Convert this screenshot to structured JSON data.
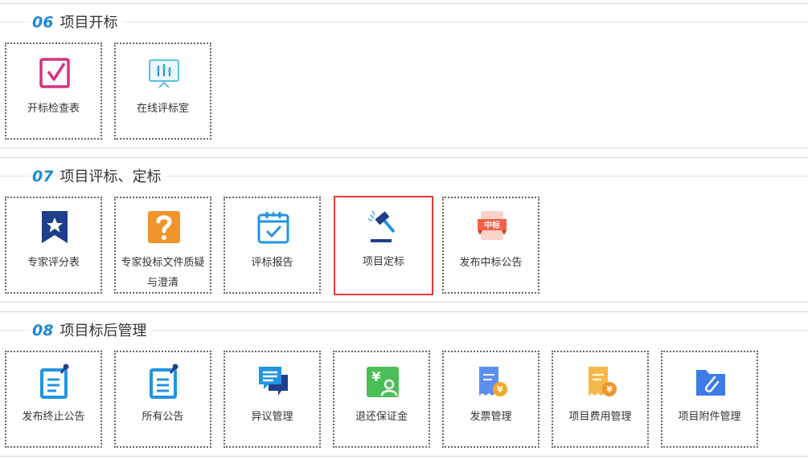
{
  "sections": [
    {
      "number": "06",
      "title": "项目开标",
      "tiles": [
        {
          "label": "开标检查表",
          "icon": "checkbox-icon"
        },
        {
          "label": "在线评标室",
          "icon": "presentation-board-icon"
        }
      ]
    },
    {
      "number": "07",
      "title": "项目评标、定标",
      "tiles": [
        {
          "label": "专家评分表",
          "icon": "star-ribbon-icon"
        },
        {
          "label": "专家投标文件质疑与澄清",
          "icon": "question-mark-icon"
        },
        {
          "label": "评标报告",
          "icon": "calendar-check-icon"
        },
        {
          "label": "项目定标",
          "icon": "gavel-icon"
        },
        {
          "label": "发布中标公告",
          "icon": "award-banner-icon",
          "badge": "中标"
        }
      ]
    },
    {
      "number": "08",
      "title": "项目标后管理",
      "tiles": [
        {
          "label": "发布终止公告",
          "icon": "notice-pin-icon"
        },
        {
          "label": "所有公告",
          "icon": "notice-list-pin-icon"
        },
        {
          "label": "异议管理",
          "icon": "chat-bubbles-icon"
        },
        {
          "label": "退还保证金",
          "icon": "yuan-refund-icon",
          "badge": "¥"
        },
        {
          "label": "发票管理",
          "icon": "invoice-icon",
          "badge": "¥"
        },
        {
          "label": "项目费用管理",
          "icon": "receipt-yuan-icon",
          "badge": "¥"
        },
        {
          "label": "项目附件管理",
          "icon": "attachment-folder-icon"
        }
      ]
    }
  ],
  "selected": "项目定标",
  "colors": {
    "accent": "#1e88d8",
    "selected_border": "#e03a3a",
    "pink": "#d6317f",
    "teal": "#5bc0de",
    "navy": "#1f3f8c",
    "orange": "#f0942c",
    "blue": "#2394e0",
    "green": "#4bbf57",
    "red_banner": "#f26149"
  }
}
